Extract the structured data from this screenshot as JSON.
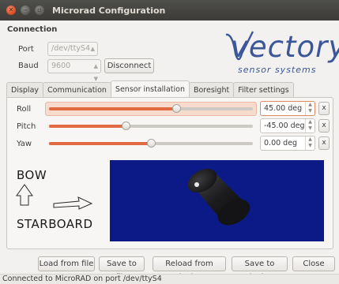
{
  "window": {
    "title": "Microrad Configuration"
  },
  "connection": {
    "heading": "Connection",
    "port_label": "Port",
    "port_value": "/dev/ttyS4",
    "baud_label": "Baud",
    "baud_value": "9600",
    "disconnect_label": "Disconnect"
  },
  "logo": {
    "name": "vectory",
    "tagline": "sensor systems",
    "color": "#3b5699"
  },
  "tabs": [
    {
      "label": "Display"
    },
    {
      "label": "Communication"
    },
    {
      "label": "Sensor installation"
    },
    {
      "label": "Boresight"
    },
    {
      "label": "Filter settings"
    }
  ],
  "active_tab": "Sensor installation",
  "sensor": {
    "rows": [
      {
        "label": "Roll",
        "value": "45.00 deg",
        "slider_fraction": 0.625,
        "clear_label": "x"
      },
      {
        "label": "Pitch",
        "value": "-45.00 deg",
        "slider_fraction": 0.375,
        "clear_label": "x"
      },
      {
        "label": "Yaw",
        "value": "0.00 deg",
        "slider_fraction": 0.5,
        "clear_label": "x"
      }
    ],
    "bow_label": "BOW",
    "starboard_label": "STARBOARD",
    "viewport_color": "#0b1a86"
  },
  "buttons": {
    "load_file": "Load from file",
    "save_file": "Save to file",
    "reload_device": "Reload from device",
    "save_device": "Save to device",
    "close": "Close"
  },
  "status": "Connected to MicroRAD on port /dev/ttyS4",
  "colors": {
    "accent": "#e06a42",
    "titlebar": "#3c3b37"
  }
}
